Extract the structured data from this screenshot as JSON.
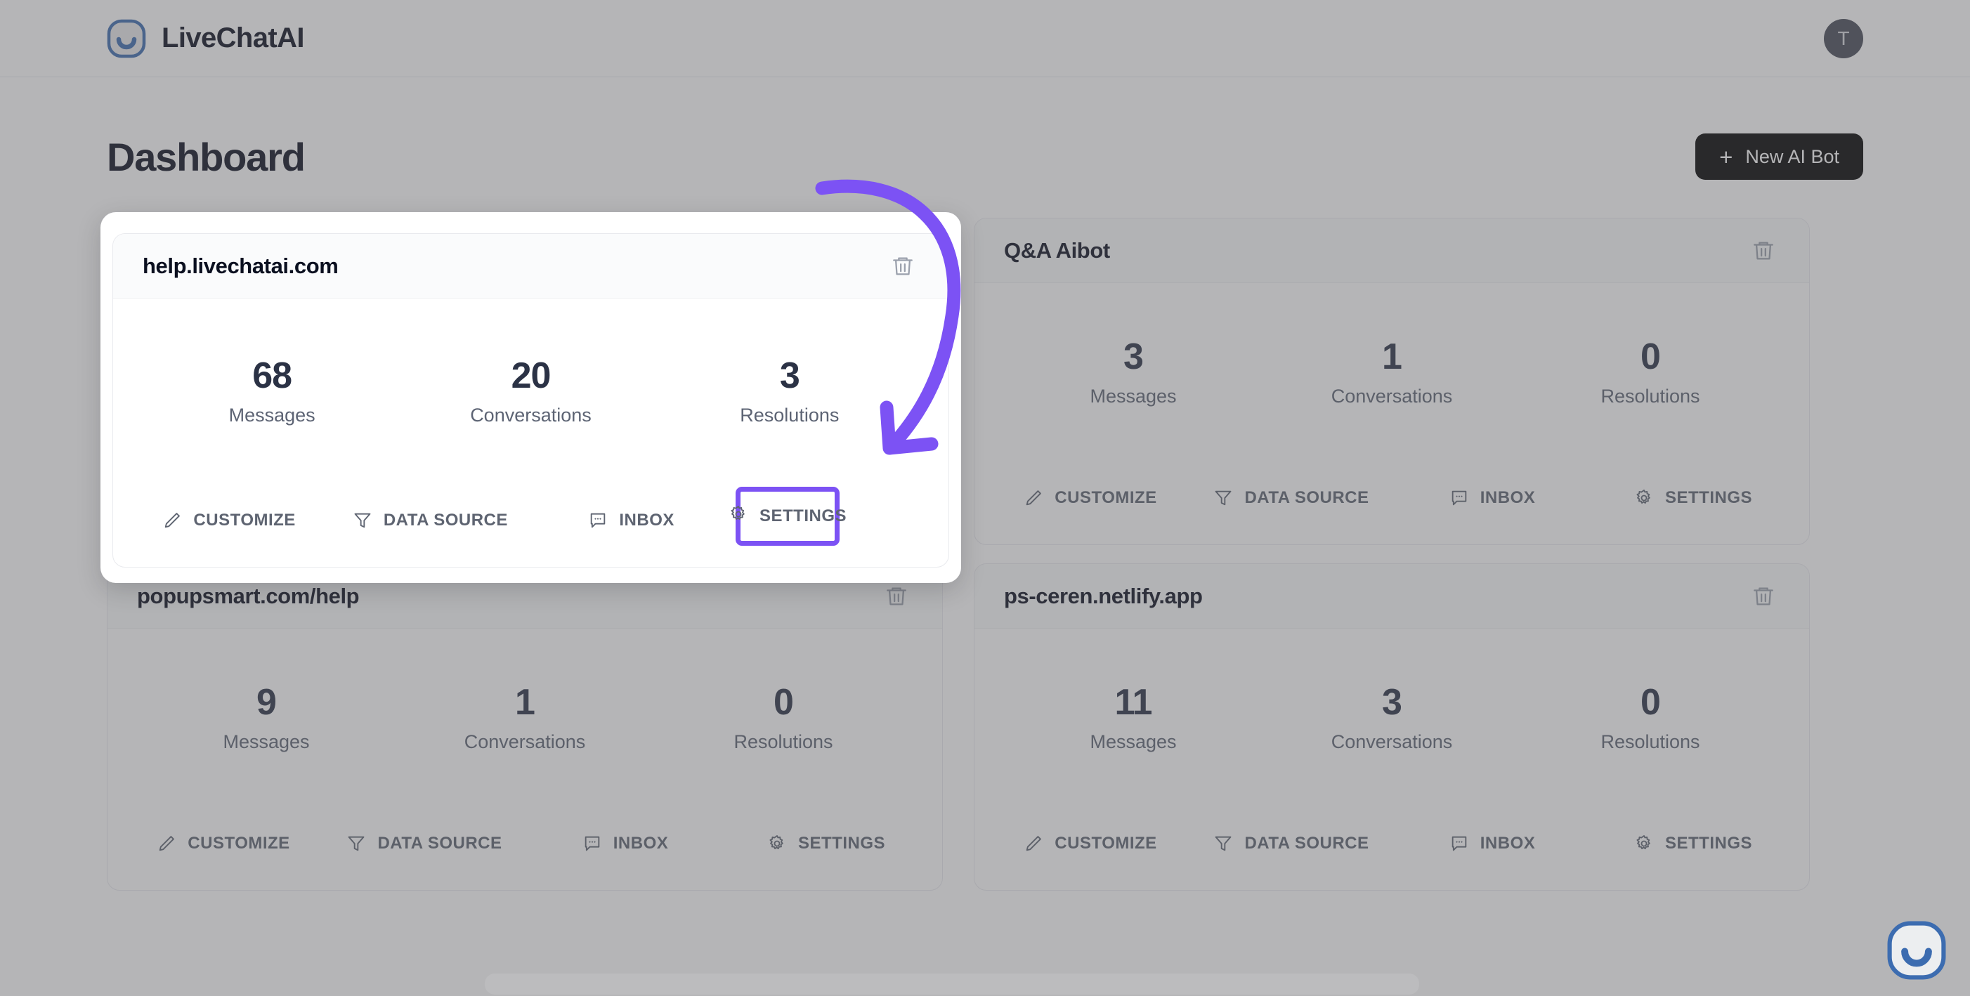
{
  "header": {
    "brand_name": "LiveChatAI",
    "logo_icon": "livechatai-smile-logo",
    "avatar_initial": "T"
  },
  "page": {
    "title": "Dashboard",
    "new_bot_button": {
      "label": "New AI Bot",
      "plus_icon": "plus-icon"
    }
  },
  "card_labels": {
    "messages": "Messages",
    "conversations": "Conversations",
    "resolutions": "Resolutions",
    "customize": "CUSTOMIZE",
    "data_source": "DATA SOURCE",
    "inbox": "INBOX",
    "settings": "SETTINGS",
    "delete_icon": "trash-icon",
    "customize_icon": "pencil-icon",
    "data_source_icon": "funnel-icon",
    "inbox_icon": "chat-bubble-icon",
    "settings_icon": "gear-icon"
  },
  "bots": [
    {
      "name": "help.livechatai.com",
      "messages": "68",
      "conversations": "20",
      "resolutions": "3"
    },
    {
      "name": "Q&A Aibot",
      "messages": "3",
      "conversations": "1",
      "resolutions": "0"
    },
    {
      "name": "popupsmart.com/help",
      "messages": "9",
      "conversations": "1",
      "resolutions": "0"
    },
    {
      "name": "ps-ceren.netlify.app",
      "messages": "11",
      "conversations": "3",
      "resolutions": "0"
    }
  ],
  "tour": {
    "highlight_target": "SETTINGS",
    "arrow_icon": "curved-arrow-down-icon",
    "accent_color": "#7c52f4"
  },
  "chat_widget": {
    "icon": "livechatai-smile-logo"
  },
  "colors": {
    "accent_purple": "#7c52f4",
    "button_black": "#000000",
    "text_dark": "#0b1020",
    "text_muted": "#5e6471",
    "avatar_bg": "#474c58",
    "logo_blue": "#3c6cb0"
  }
}
